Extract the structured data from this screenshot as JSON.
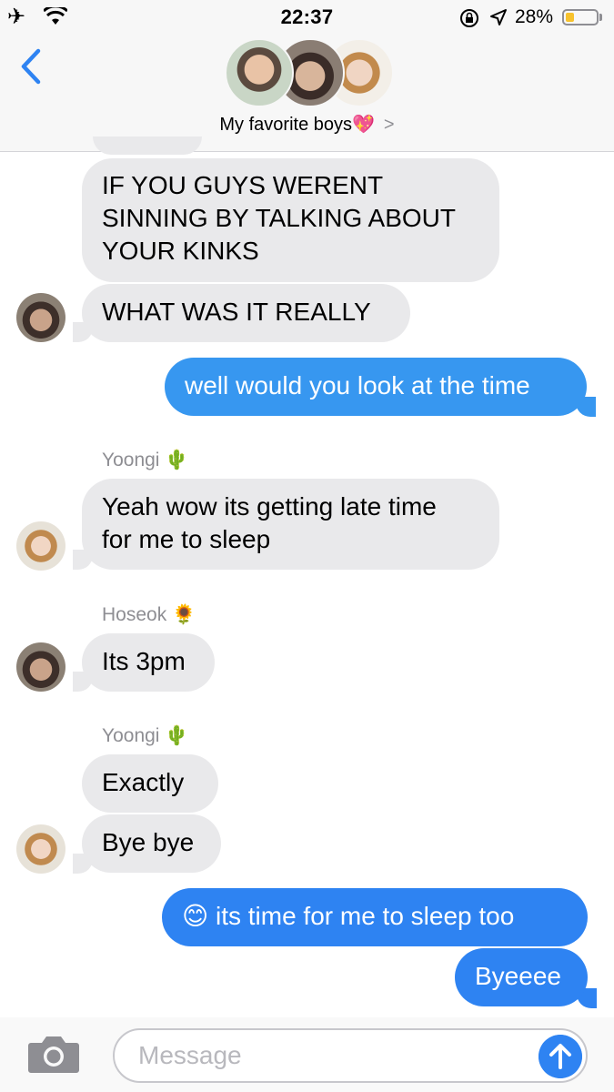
{
  "status_bar": {
    "time": "22:37",
    "battery_percent": "28%",
    "battery_level": 0.28,
    "icons": [
      "airplane-icon",
      "wifi-icon",
      "rotation-lock-icon",
      "location-icon",
      "battery-icon"
    ]
  },
  "header": {
    "group_name": "My favorite boys💖",
    "chevron": ">"
  },
  "messages": [
    {
      "from": "them",
      "text_lines": [
        "IF YOU GUYS WERENT",
        "SINNING BY TALKING ABOUT",
        "YOUR KINKS"
      ]
    },
    {
      "from": "them",
      "text": "WHAT WAS IT REALLY"
    },
    {
      "from": "me",
      "text": "well would you look at the time"
    },
    {
      "from": "them",
      "sender": "Yoongi 🌵",
      "text_lines": [
        "Yeah wow its getting late time",
        "for me to sleep"
      ]
    },
    {
      "from": "them",
      "sender": "Hoseok 🌻",
      "text": "Its 3pm"
    },
    {
      "from": "them",
      "sender": "Yoongi 🌵",
      "text": "Exactly"
    },
    {
      "from": "them",
      "text": "Bye bye"
    },
    {
      "from": "me",
      "text": "😊 its time for me to sleep too"
    },
    {
      "from": "me",
      "text": "Byeeee"
    }
  ],
  "composer": {
    "placeholder": "Message"
  },
  "colors": {
    "incoming_bubble": "#e9e9eb",
    "outgoing_bubble": "#3797f0",
    "send_button": "#2e83f2",
    "back_arrow": "#2e83f2"
  }
}
